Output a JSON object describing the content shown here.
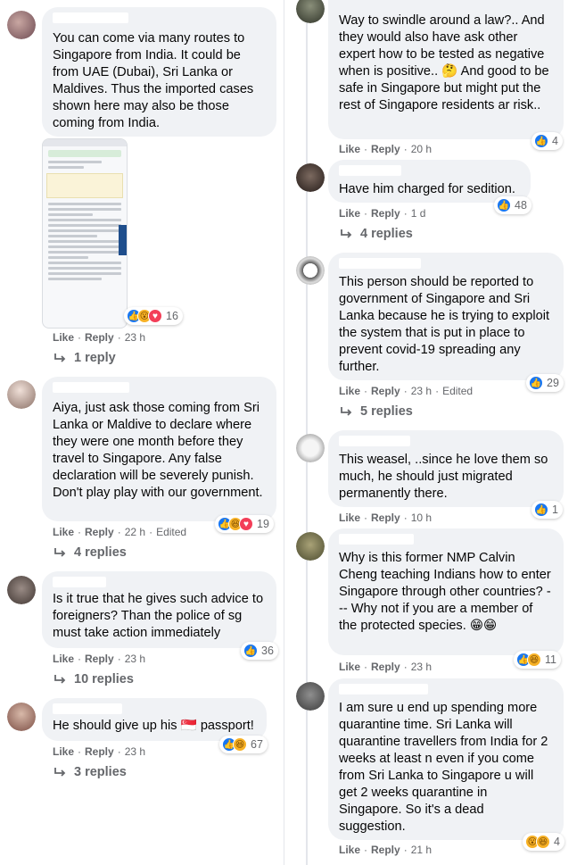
{
  "labels": {
    "like": "Like",
    "reply": "Reply",
    "dot": "·",
    "edited": "Edited"
  },
  "left": [
    {
      "text": "You can come via many routes to Singapore from India. It could be from UAE (Dubai), Sri Lanka or Maldives. Thus the imported cases shown here may also be those coming from India.",
      "attachment": "screenshot",
      "reactions": [
        "like",
        "wow",
        "love"
      ],
      "count": "16",
      "time": "23 h",
      "replies": "1 reply"
    },
    {
      "text": "Aiya, just ask those coming from Sri Lanka or Maldive to declare where they were one month before they travel to Singapore. Any false declaration will be severely punish. Don't play play with our government.",
      "reactions": [
        "like",
        "haha",
        "love"
      ],
      "count": "19",
      "time": "22 h",
      "edited": true,
      "replies": "4 replies"
    },
    {
      "text": "Is it true that he gives such advice to foreigners? Than the police of sg must take action immediately",
      "reactions": [
        "like"
      ],
      "count": "36",
      "time": "23 h",
      "replies": "10 replies"
    },
    {
      "text": "He should give up his 🇸🇬 passport!",
      "reactions": [
        "like",
        "haha"
      ],
      "count": "67",
      "time": "23 h",
      "replies": "3 replies"
    }
  ],
  "right": [
    {
      "text": "Way to swindle around a law?.. And they would also have ask other expert how to be tested as negative when is positive.. 🤔 And good to be safe in Singapore but might put the rest of Singapore residents ar risk..",
      "reactions": [
        "like"
      ],
      "count": "4",
      "time": "20 h"
    },
    {
      "text": "Have him charged for sedition.",
      "reactions": [
        "like"
      ],
      "count": "48",
      "time": "1 d",
      "replies": "4 replies"
    },
    {
      "text": "This person should be reported to government of Singapore and Sri Lanka because he is trying to exploit the system that is put in place to prevent covid-19 spreading any further.",
      "reactions": [
        "like"
      ],
      "count": "29",
      "time": "23 h",
      "edited": true,
      "replies": "5 replies"
    },
    {
      "text": "This weasel, ..since he love them so much, he should just migrated permanently there.",
      "reactions": [
        "like"
      ],
      "count": "1",
      "time": "10 h"
    },
    {
      "text": "Why is this former NMP Calvin Cheng teaching Indians how to enter Singapore through other countries? --- Why not if you are a member of the protected species. 😁😁",
      "reactions": [
        "like",
        "haha"
      ],
      "count": "11",
      "time": "23 h"
    },
    {
      "text": "I am sure u end up spending more quarantine time. Sri Lanka will quarantine travellers from India for 2 weeks at least n even if you come from Sri Lanka to Singapore u will get 2 weeks quarantine in Singapore. So it's a dead suggestion.",
      "reactions": [
        "wow",
        "haha"
      ],
      "count": "4",
      "time": "21 h"
    }
  ]
}
